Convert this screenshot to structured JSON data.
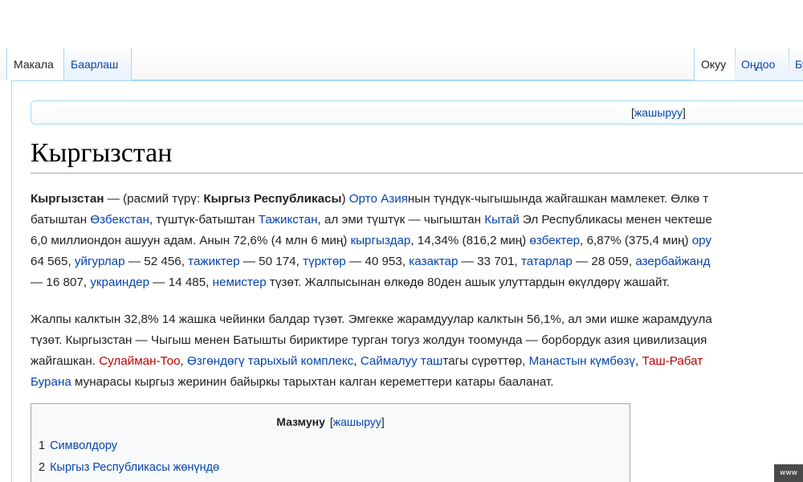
{
  "tabs": {
    "left": [
      {
        "label": "Макала",
        "selected": true
      },
      {
        "label": "Баарлаш",
        "selected": false
      }
    ],
    "right": [
      {
        "label": "Окуу",
        "selected": true
      },
      {
        "label": "Оңдоо",
        "selected": false
      },
      {
        "label": "Бу",
        "selected": false
      }
    ]
  },
  "sitenotice": {
    "hide_link": "жашыруу",
    "bracket_open": "[",
    "bracket_close": "]"
  },
  "page": {
    "title": "Кыргызстан"
  },
  "paragraph1": {
    "l1": {
      "bold1": "Кыргызстан",
      "t1": " — (расмий түрү: ",
      "bold2": "Кыргыз Республикасы",
      "t2": ") ",
      "link1": "Орто Азия",
      "t3": "нын түндүк-чыгышында жайгашкан мамлекет. Өлкө т"
    },
    "l2": {
      "t1": "батыштан ",
      "link1": "Өзбекстан",
      "t2": ", түштүк-батыштан ",
      "link2": "Тажикстан",
      "t3": ", ал эми түштүк — чыгыштан ",
      "link3": "Кытай",
      "t4": " Эл Республикасы менен чектеше"
    },
    "l3": {
      "t1": "6,0 миллиондон ашуун адам. Анын 72,6% (4 млн 6 миң) ",
      "link1": "кыргыздар",
      "t2": ", 14,34% (816,2 миң) ",
      "link2": "өзбектер",
      "t3": ", 6,87% (375,4 миң) ",
      "link3": "ору"
    },
    "l4": {
      "t1": "64 565, ",
      "link1": "уйгурлар",
      "t2": " — 52 456, ",
      "link2": "тажиктер",
      "t3": " — 50 174, ",
      "link3": "түрктөр",
      "t4": " — 40 953, ",
      "link4": "казактар",
      "t5": " — 33 701, ",
      "link5": "татарлар",
      "t6": " — 28 059, ",
      "link6": "азербайжанд"
    },
    "l5": {
      "t1": "— 16 807, ",
      "link1": "украиндер",
      "t2": " — 14 485, ",
      "link2": "немистер",
      "t3": " түзөт. Жалпысынан өлкөдө 80ден ашык улуттардын өкүлдөрү жашайт."
    }
  },
  "paragraph2": {
    "l1": {
      "t1": "Жалпы калктын 32,8% 14 жашка чейинки балдар түзөт. Эмгекке жарамдуулар калктын 56,1%, ал эми ишке жарамдуула"
    },
    "l2": {
      "t1": "түзөт. Кыргызстан — Чыгыш менен Батышты бириктире турган тогуз жолдун тоомунда — борбордук азия цивилизация"
    },
    "l3": {
      "t1": "жайгашкан. ",
      "red1": "Сулайман-Тоо",
      "t2": ", ",
      "link1": "Өзгөндөгү тарыхый комплекс",
      "t3": ", ",
      "link2": "Саймалуу таш",
      "t4": "тагы сүрөттөр, ",
      "link3": "Манастын күмбөзү",
      "t5": ", ",
      "red2": "Таш-Рабат"
    },
    "l4": {
      "link1": "Бурана",
      "t1": " мунарасы кыргыз жеринин байыркы тарыхтан калган кереметтери катары бааланат."
    }
  },
  "toc": {
    "title": "Мазмуну",
    "bracket_open": "[",
    "hide_link": "жашыруу",
    "bracket_close": "]",
    "items": [
      {
        "number": "1",
        "label": "Символдору"
      },
      {
        "number": "2",
        "label": "Кыргыз Республикасы жөнүндө"
      }
    ]
  },
  "watermark": {
    "text": "www"
  }
}
